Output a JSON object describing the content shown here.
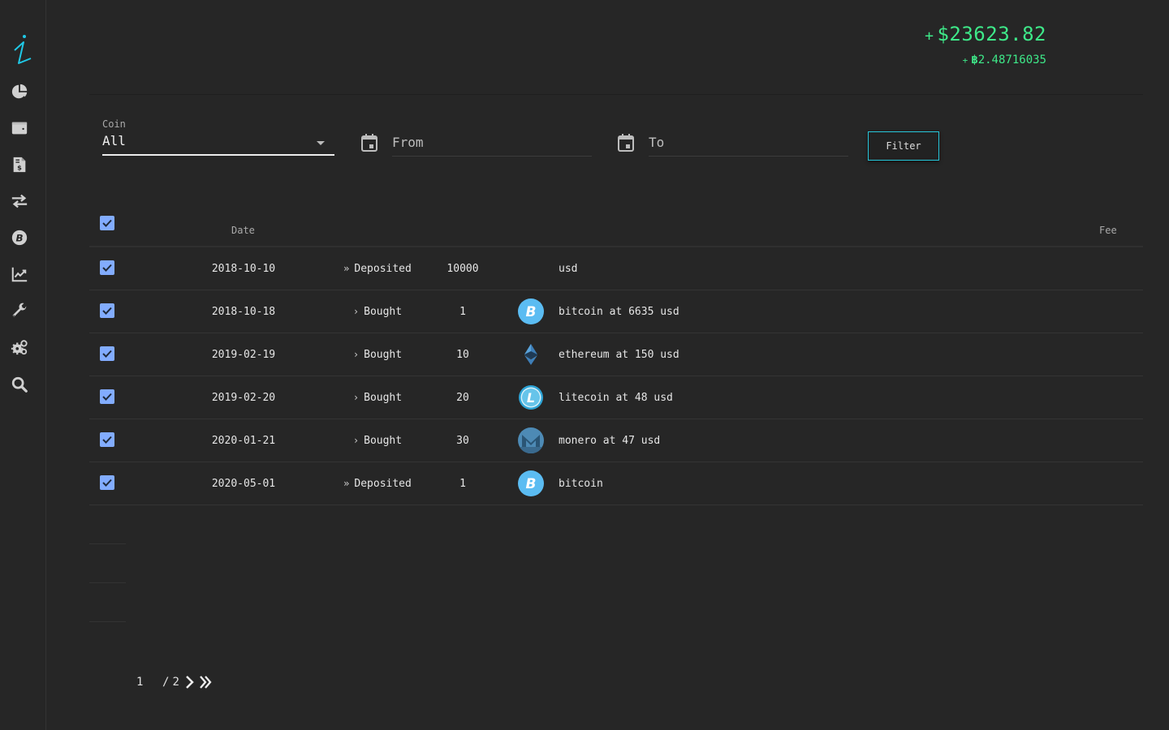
{
  "sidebar": {
    "logo": "i-logo",
    "items": [
      {
        "name": "portfolio",
        "icon": "pie-chart-icon"
      },
      {
        "name": "wallet",
        "icon": "wallet-icon"
      },
      {
        "name": "invoice",
        "icon": "invoice-icon"
      },
      {
        "name": "transactions",
        "icon": "exchange-arrows-icon"
      },
      {
        "name": "bitcoin",
        "icon": "bitcoin-icon"
      },
      {
        "name": "charts",
        "icon": "area-chart-icon"
      },
      {
        "name": "tools",
        "icon": "wrench-icon"
      },
      {
        "name": "settings",
        "icon": "gears-icon"
      },
      {
        "name": "search",
        "icon": "search-icon"
      }
    ]
  },
  "totals": {
    "usd_sign": "+",
    "usd_value": "$23623.82",
    "btc_sign": "+",
    "btc_symbol": "฿",
    "btc_value": "2.48716035",
    "color": "#3ee989"
  },
  "filters": {
    "coin_label": "Coin",
    "coin_value": "All",
    "from_placeholder": "From",
    "to_placeholder": "To",
    "filter_button": "Filter"
  },
  "table": {
    "headers": {
      "date": "Date",
      "fee": "Fee"
    },
    "rows": [
      {
        "checked": true,
        "date": "2018-10-10",
        "type_glyph": "»",
        "type": "Deposited",
        "amount": "10000",
        "coin_icon": "",
        "description": "usd"
      },
      {
        "checked": true,
        "date": "2018-10-18",
        "type_glyph": "›",
        "type": "Bought",
        "amount": "1",
        "coin_icon": "bitcoin-icon",
        "description": "bitcoin at 6635 usd"
      },
      {
        "checked": true,
        "date": "2019-02-19",
        "type_glyph": "›",
        "type": "Bought",
        "amount": "10",
        "coin_icon": "ethereum-icon",
        "description": "ethereum at 150 usd"
      },
      {
        "checked": true,
        "date": "2019-02-20",
        "type_glyph": "›",
        "type": "Bought",
        "amount": "20",
        "coin_icon": "litecoin-icon",
        "description": "litecoin at 48 usd"
      },
      {
        "checked": true,
        "date": "2020-01-21",
        "type_glyph": "›",
        "type": "Bought",
        "amount": "30",
        "coin_icon": "monero-icon",
        "description": "monero at 47 usd"
      },
      {
        "checked": true,
        "date": "2020-05-01",
        "type_glyph": "»",
        "type": "Deposited",
        "amount": "1",
        "coin_icon": "bitcoin-icon",
        "description": "bitcoin"
      }
    ]
  },
  "pagination": {
    "current": "1",
    "separator": "/",
    "total": "2"
  },
  "colors": {
    "accent": "#26c6da",
    "checkbox": "#82acff",
    "positive": "#3ee989",
    "background": "#262626"
  }
}
